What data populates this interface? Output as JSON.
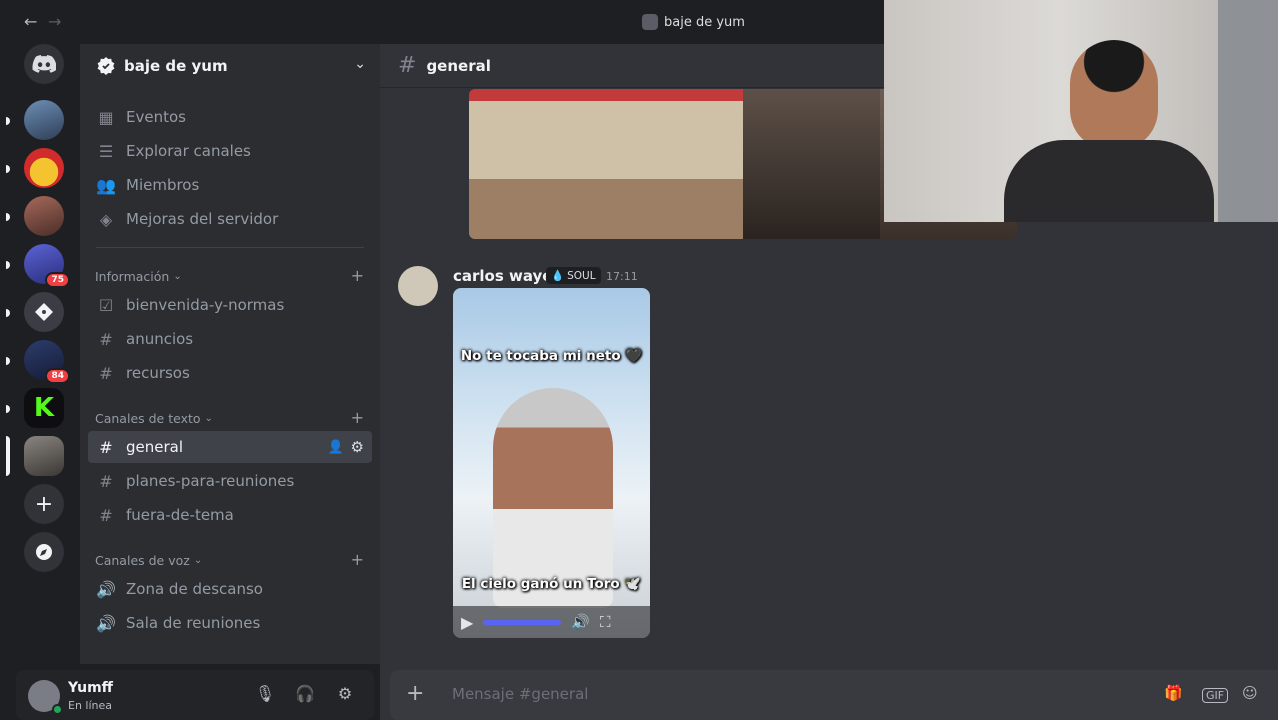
{
  "titlebar": {
    "back_icon": "arrow-left-icon",
    "forward_icon": "arrow-right-icon",
    "title": "baje de yum"
  },
  "rail": {
    "servers": [
      {
        "name": "discord-home",
        "badge": ""
      },
      {
        "name": "server-1",
        "badge": ""
      },
      {
        "name": "server-2",
        "badge": ""
      },
      {
        "name": "server-3",
        "badge": ""
      },
      {
        "name": "server-4",
        "badge": "75"
      },
      {
        "name": "server-5",
        "badge": ""
      },
      {
        "name": "server-6",
        "badge": "84"
      },
      {
        "name": "server-7",
        "badge": ""
      },
      {
        "name": "server-8",
        "badge": ""
      }
    ],
    "add_icon": "plus-icon",
    "discover_icon": "compass-icon"
  },
  "sidebar": {
    "guild_name": "baje de yum",
    "nav": [
      {
        "label": "Eventos",
        "icon": "calendar-icon"
      },
      {
        "label": "Explorar canales",
        "icon": "browse-channels-icon"
      },
      {
        "label": "Miembros",
        "icon": "members-icon"
      },
      {
        "label": "Mejoras del servidor",
        "icon": "boost-icon"
      }
    ],
    "categories": {
      "info": "Información",
      "text": "Canales de texto",
      "voice": "Canales de voz"
    },
    "info_channels": [
      "bienvenida-y-normas",
      "anuncios",
      "recursos"
    ],
    "text_channels": [
      "general",
      "planes-para-reuniones",
      "fuera-de-tema"
    ],
    "voice_channels": [
      "Zona de descanso",
      "Sala de reuniones"
    ]
  },
  "user": {
    "name": "Yumff",
    "status": "En línea"
  },
  "chat": {
    "channel": "general",
    "message": {
      "author": "carlos wayer",
      "tag": "SOUL",
      "time": "17:11",
      "video_caption_top": "No te tocaba mi neto 🖤",
      "video_caption_bottom": "El cielo ganó un Toro 🕊️"
    }
  },
  "composer": {
    "placeholder": "Mensaje #general"
  },
  "colors": {
    "accent": "#5865f2",
    "online": "#23a55a",
    "badge": "#f23f43"
  }
}
